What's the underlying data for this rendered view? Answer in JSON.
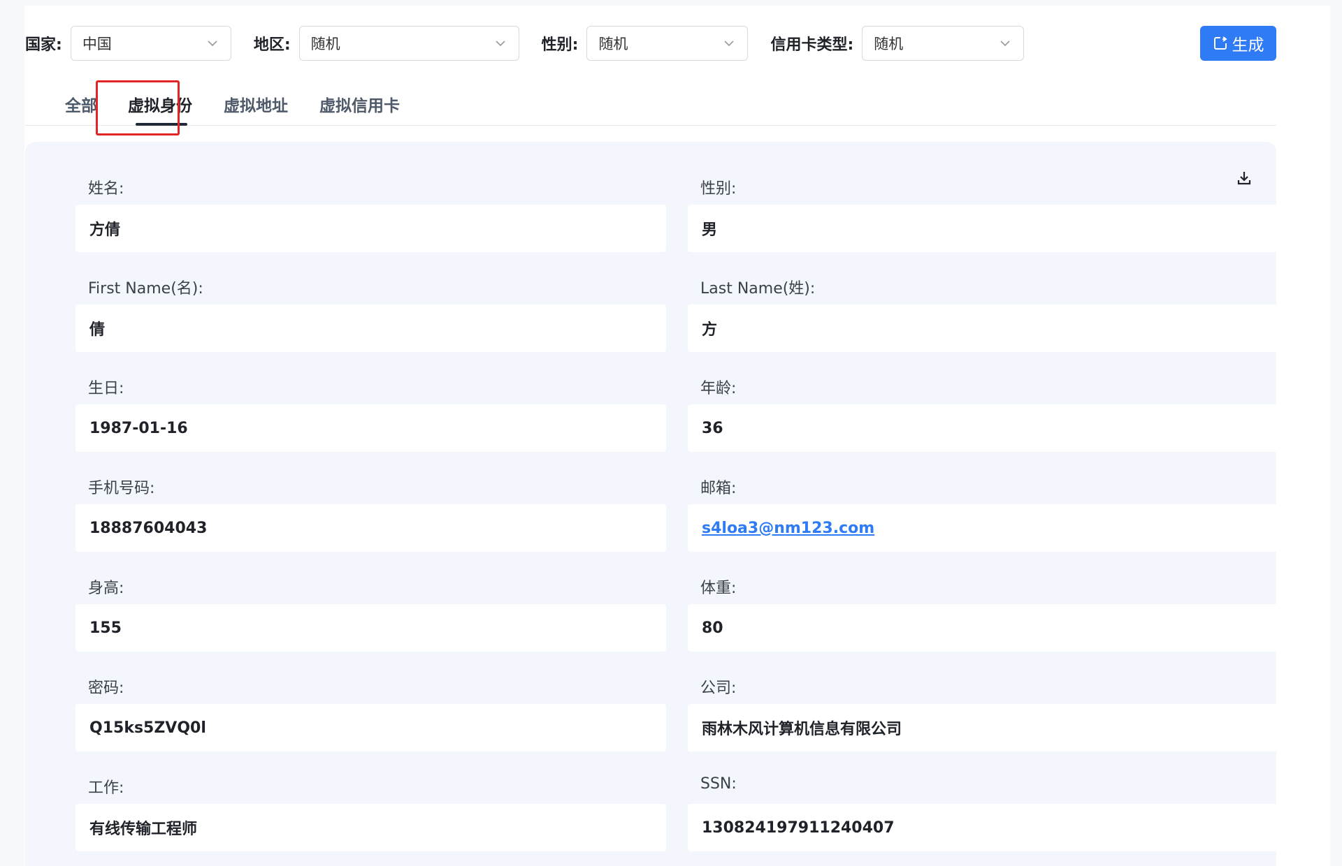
{
  "filters": {
    "country": {
      "label": "国家:",
      "value": "中国"
    },
    "region": {
      "label": "地区:",
      "value": "随机"
    },
    "gender": {
      "label": "性别:",
      "value": "随机"
    },
    "card_type": {
      "label": "信用卡类型:",
      "value": "随机"
    },
    "generate_label": "生成"
  },
  "tabs": [
    {
      "label": "全部"
    },
    {
      "label": "虚拟身份"
    },
    {
      "label": "虚拟地址"
    },
    {
      "label": "虚拟信用卡"
    }
  ],
  "active_tab": "虚拟身份",
  "fields": {
    "name": {
      "label": "姓名:",
      "value": "方倩"
    },
    "gender": {
      "label": "性别:",
      "value": "男"
    },
    "first_name": {
      "label": "First Name(名):",
      "value": "倩"
    },
    "last_name": {
      "label": "Last Name(姓):",
      "value": "方"
    },
    "birthday": {
      "label": "生日:",
      "value": "1987-01-16"
    },
    "age": {
      "label": "年龄:",
      "value": "36"
    },
    "phone": {
      "label": "手机号码:",
      "value": "18887604043"
    },
    "email": {
      "label": "邮箱:",
      "value": "s4loa3@nm123.com"
    },
    "height": {
      "label": "身高:",
      "value": "155"
    },
    "weight": {
      "label": "体重:",
      "value": "80"
    },
    "password": {
      "label": "密码:",
      "value": "Q15ks5ZVQ0l"
    },
    "company": {
      "label": "公司:",
      "value": "雨林木风计算机信息有限公司"
    },
    "job": {
      "label": "工作:",
      "value": "有线传输工程师"
    },
    "ssn": {
      "label": "SSN:",
      "value": "130824197911240407"
    }
  },
  "colors": {
    "accent": "#2f7bf5",
    "highlight": "#e32424",
    "card_bg": "#f3f7fd"
  },
  "icons": {
    "generate": "refresh-icon",
    "download": "download-icon",
    "select_arrow": "chevron-down-icon"
  }
}
